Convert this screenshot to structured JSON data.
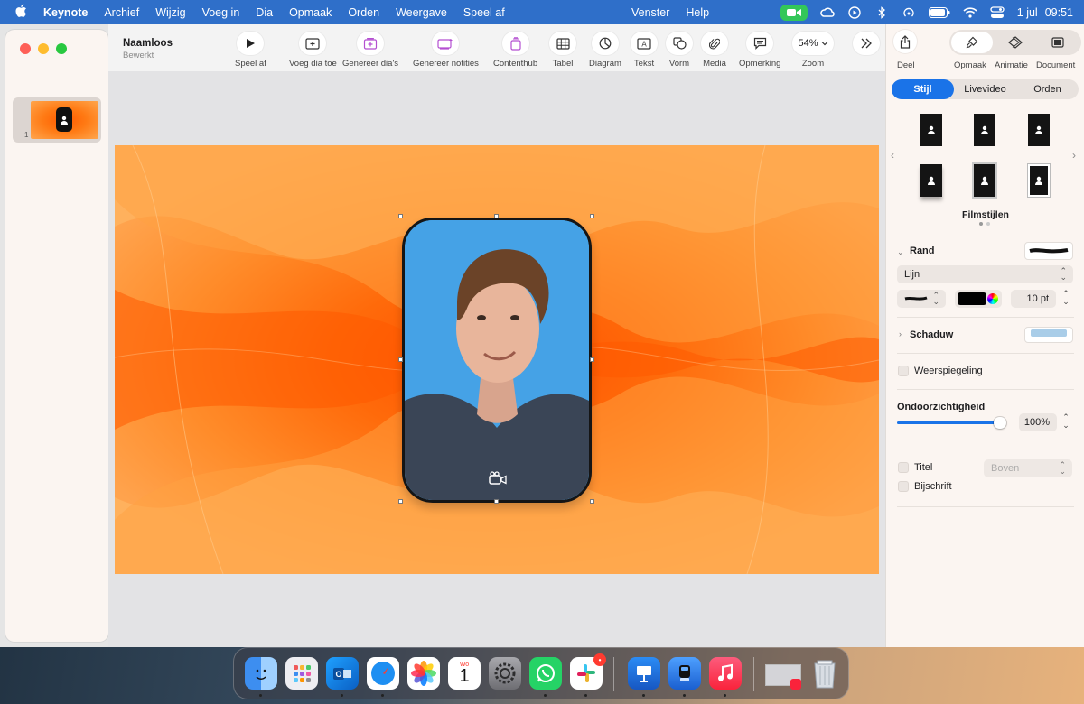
{
  "menubar": {
    "app_name": "Keynote",
    "menus": [
      "Archief",
      "Wijzig",
      "Voeg in",
      "Dia",
      "Opmaak",
      "Orden",
      "Weergave",
      "Speel af"
    ],
    "center_menus": [
      "Venster",
      "Help"
    ],
    "date": "1 jul",
    "time": "09:51",
    "status_icons": [
      "facetime-icon",
      "creative-cloud-icon",
      "play-circle-icon",
      "bluetooth-icon",
      "airdrop-icon",
      "battery-icon",
      "wifi-icon",
      "control-center-icon"
    ]
  },
  "document": {
    "title": "Naamloos",
    "subtitle": "Bewerkt"
  },
  "sidebar": {
    "slides": [
      {
        "number": "1"
      }
    ]
  },
  "toolbar": {
    "buttons": [
      {
        "label": "Speel af",
        "icon": "play-icon"
      },
      {
        "label": "Voeg dia toe",
        "icon": "add-slide-icon"
      },
      {
        "label": "Genereer dia's",
        "icon": "generate-slides-icon"
      },
      {
        "label": "Genereer notities",
        "icon": "generate-notes-icon"
      },
      {
        "label": "Contenthub",
        "icon": "contenthub-icon"
      },
      {
        "label": "Tabel",
        "icon": "table-icon"
      },
      {
        "label": "Diagram",
        "icon": "chart-icon"
      },
      {
        "label": "Tekst",
        "icon": "text-icon"
      },
      {
        "label": "Vorm",
        "icon": "shape-icon"
      },
      {
        "label": "Media",
        "icon": "media-icon"
      },
      {
        "label": "Opmerking",
        "icon": "comment-icon"
      }
    ],
    "zoom_value": "54%",
    "zoom_label": "Zoom",
    "overflow_icon": "chevron-double-right-icon"
  },
  "inspector": {
    "share_label": "Deel",
    "modes": [
      {
        "label": "Opmaak",
        "icon": "paintbrush-icon",
        "active": true
      },
      {
        "label": "Animatie",
        "icon": "diamond-icon",
        "active": false
      },
      {
        "label": "Document",
        "icon": "document-icon",
        "active": false
      }
    ],
    "tabs": [
      {
        "label": "Stijl",
        "active": true
      },
      {
        "label": "Livevideo",
        "active": false
      },
      {
        "label": "Orden",
        "active": false
      }
    ],
    "style_caption": "Filmstijlen",
    "border": {
      "label": "Rand",
      "type": "Lijn",
      "width": "10 pt",
      "color": "#000000"
    },
    "shadow_label": "Schaduw",
    "reflection_label": "Weerspiegeling",
    "opacity": {
      "label": "Ondoorzichtigheid",
      "value": "100%",
      "level": 1.0
    },
    "title_label": "Titel",
    "title_position": "Boven",
    "caption_label": "Bijschrift"
  },
  "dock": {
    "apps": [
      {
        "name": "Finder",
        "icon": "finder-icon",
        "color": "#3d8ef0",
        "running": true
      },
      {
        "name": "Launchpad",
        "icon": "launchpad-icon",
        "color": "#e8e8ee",
        "running": false
      },
      {
        "name": "Outlook",
        "icon": "outlook-icon",
        "color": "#1479d6",
        "running": true
      },
      {
        "name": "Safari",
        "icon": "safari-icon",
        "color": "#2a95f5",
        "running": true
      },
      {
        "name": "Foto's",
        "icon": "photos-icon",
        "color": "#ffffff",
        "running": false
      },
      {
        "name": "Agenda",
        "icon": "calendar-icon",
        "color": "#ffffff",
        "running": false
      },
      {
        "name": "Systeeminstellingen",
        "icon": "settings-icon",
        "color": "#8e8e93",
        "running": false
      },
      {
        "name": "WhatsApp",
        "icon": "whatsapp-icon",
        "color": "#25d366",
        "running": true
      },
      {
        "name": "Slack",
        "icon": "slack-icon",
        "color": "#ffffff",
        "running": true
      },
      {
        "name": "Keynote",
        "icon": "keynote-icon",
        "color": "#1e6fd9",
        "running": true
      },
      {
        "name": "Marker",
        "icon": "marker-icon",
        "color": "#3a86f0",
        "running": true
      },
      {
        "name": "Muziek",
        "icon": "music-icon",
        "color": "#fa2d48",
        "running": true
      },
      {
        "name": "Recent",
        "icon": "recent-document-icon",
        "color": "#d9d9d9",
        "running": false
      },
      {
        "name": "Prullenmand",
        "icon": "trash-icon",
        "color": "#cfd4da",
        "running": false
      }
    ],
    "calendar_weekday": "Wo",
    "calendar_day": "1",
    "slack_badge": "•"
  },
  "colors": {
    "accent": "#1a73e8",
    "menubar": "#2f6fc9",
    "slide_center": "#ff5000",
    "slide_edge": "#ffa34d",
    "portrait_background": "#43a0e4"
  }
}
